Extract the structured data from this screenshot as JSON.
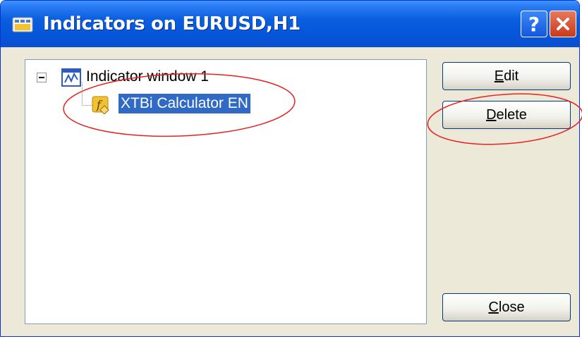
{
  "window": {
    "title": "Indicators on EURUSD,H1"
  },
  "titlebar_buttons": {
    "help_label": "?",
    "help_icon": "question-mark-icon",
    "close_icon": "close-x-icon"
  },
  "tree": {
    "root": {
      "label": "Indicator window 1",
      "icon": "chart-window-icon",
      "expanded": true
    },
    "children": [
      {
        "label": "XTBi Calculator EN",
        "icon": "custom-indicator-fx-icon",
        "selected": true
      }
    ]
  },
  "buttons": {
    "edit": {
      "accel": "E",
      "rest": "dit"
    },
    "delete": {
      "accel": "D",
      "rest": "elete"
    },
    "close": {
      "accel": "C",
      "rest": "lose"
    }
  },
  "colors": {
    "titlebar": "#0a5fdf",
    "selection": "#316ac5",
    "annotation": "#e82020"
  }
}
